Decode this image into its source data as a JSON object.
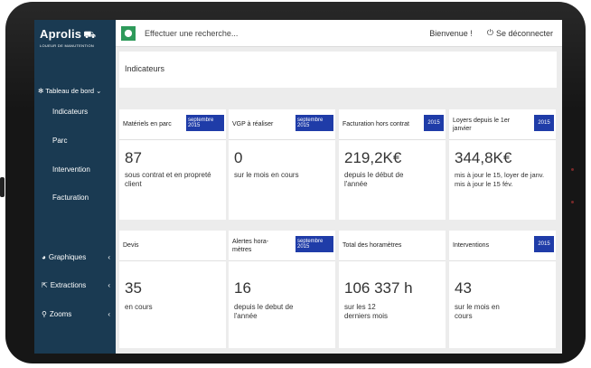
{
  "app": {
    "logo_name": "Aprolis",
    "logo_tagline": "LOUEUR DE MANUTENTION"
  },
  "topbar": {
    "search_placeholder": "Effectuer une recherche...",
    "welcome": "Bienvenue !",
    "logout": "Se déconnecter"
  },
  "sidebar": {
    "section_label": "Tableau de bord",
    "items": [
      {
        "label": "Indicateurs"
      },
      {
        "label": "Parc"
      },
      {
        "label": "Intervention"
      },
      {
        "label": "Facturation"
      }
    ],
    "groups": [
      {
        "label": "Graphiques",
        "icon": "pie-chart-icon"
      },
      {
        "label": "Extractions",
        "icon": "extract-icon"
      },
      {
        "label": "Zooms",
        "icon": "magnifier-icon"
      }
    ]
  },
  "page": {
    "title": "Indicateurs"
  },
  "cards": [
    {
      "title": "Matériels en parc",
      "badge": "septembre 2015",
      "value": "87",
      "desc": "sous contrat et en propreté client"
    },
    {
      "title": "VGP à réaliser",
      "badge": "septembre 2015",
      "value": "0",
      "desc": "sur le mois en cours"
    },
    {
      "title": "Facturation hors contrat",
      "badge": "2015",
      "value": "219,2K€",
      "desc": "depuis le début de l'année"
    },
    {
      "title": "Loyers depuis le 1er janvier",
      "badge": "2015",
      "value": "344,8K€",
      "desc": "mis à jour le 15, loyer de janv. mis à jour le 15 fév."
    },
    {
      "title": "Devis",
      "badge": "",
      "value": "35",
      "desc": "en cours"
    },
    {
      "title": "Alertes hora-mètres",
      "badge": "septembre 2015",
      "value": "16",
      "desc": "depuis le debut de l'année"
    },
    {
      "title": "Total des horamètres",
      "badge": "",
      "value": "106 337 h",
      "desc": "sur les 12 derniers mois"
    },
    {
      "title": "Interventions",
      "badge": "2015",
      "value": "43",
      "desc": "sur le mois en cours"
    }
  ],
  "colors": {
    "sidebar": "#1a3a52",
    "badge": "#1f3ca8",
    "search_pin": "#2e9a5a",
    "screen_bg": "#ececec"
  }
}
